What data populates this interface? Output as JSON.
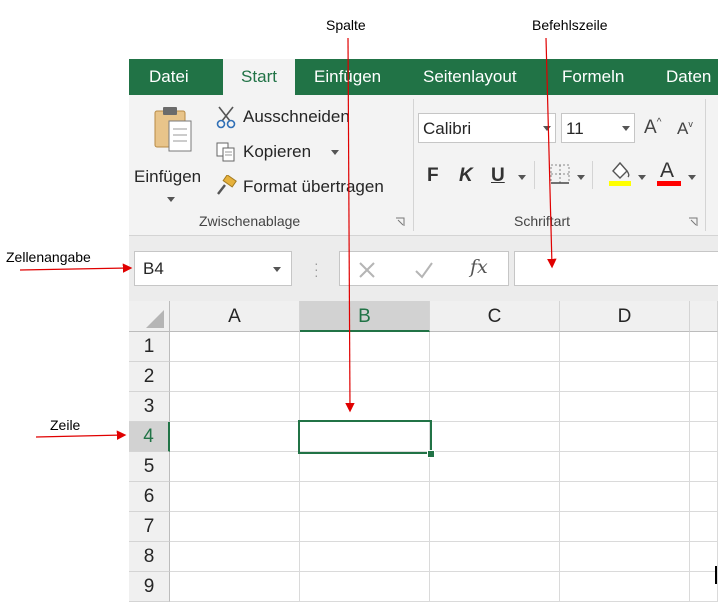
{
  "annotations": {
    "column": "Spalte",
    "formula_bar": "Befehlszeile",
    "name_box": "Zellenangabe",
    "row": "Zeile"
  },
  "tabs": [
    "Datei",
    "Start",
    "Einfügen",
    "Seitenlayout",
    "Formeln",
    "Daten"
  ],
  "active_tab": "Start",
  "clipboard": {
    "paste_label": "Einfügen",
    "cut_label": "Ausschneiden",
    "copy_label": "Kopieren",
    "format_painter_label": "Format übertragen",
    "group_label": "Zwischenablage"
  },
  "font": {
    "font_name": "Calibri",
    "font_size": "11",
    "grow_label": "A",
    "shrink_label": "A",
    "bold_label": "F",
    "italic_label": "K",
    "underline_label": "U",
    "font_color_label": "A",
    "group_label": "Schriftart",
    "highlight_color": "#ffff00",
    "font_color": "#ff0000"
  },
  "formula_bar": {
    "name_box_value": "B4",
    "fx_label": "fx",
    "formula_value": ""
  },
  "grid": {
    "columns": [
      "A",
      "B",
      "C",
      "D"
    ],
    "rows": [
      "1",
      "2",
      "3",
      "4",
      "5",
      "6",
      "7",
      "8",
      "9"
    ],
    "selected_cell": "B4"
  },
  "colors": {
    "accent": "#217346",
    "arrow": "#e00000"
  }
}
